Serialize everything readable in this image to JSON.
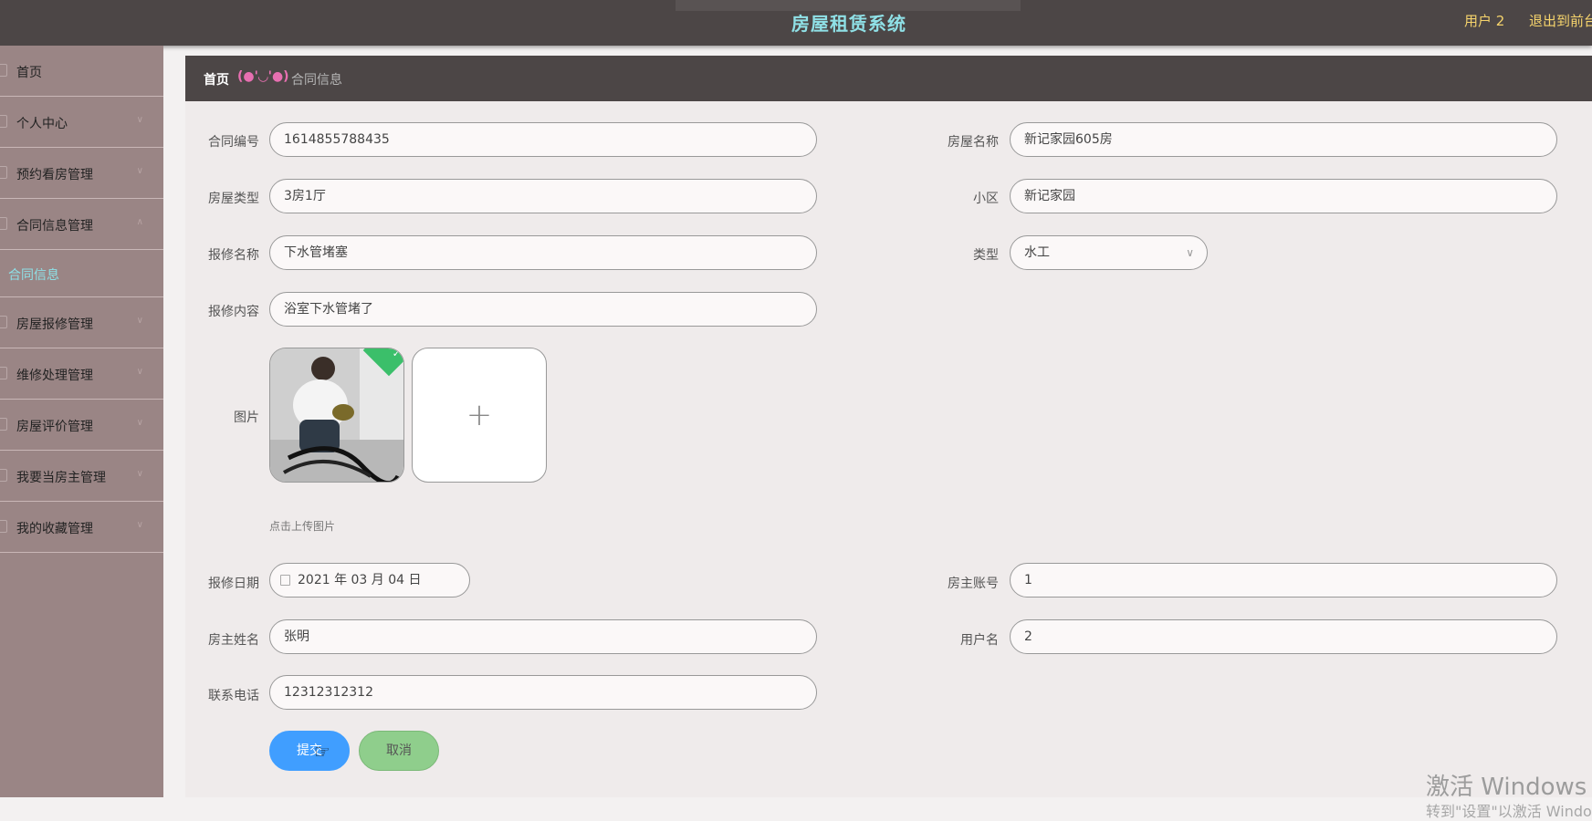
{
  "header": {
    "title": "房屋租赁系统",
    "user": "用户 2",
    "logout": "退出到前台"
  },
  "sidebar": {
    "items": [
      {
        "label": "首页"
      },
      {
        "label": "个人中心"
      },
      {
        "label": "预约看房管理"
      },
      {
        "label": "合同信息管理"
      },
      {
        "label": "合同信息",
        "active": true
      },
      {
        "label": "房屋报修管理"
      },
      {
        "label": "维修处理管理"
      },
      {
        "label": "房屋评价管理"
      },
      {
        "label": "我要当房主管理"
      },
      {
        "label": "我的收藏管理"
      }
    ]
  },
  "breadcrumb": {
    "home": "首页",
    "face": "(●'◡'●)",
    "current": "合同信息"
  },
  "form": {
    "contract_no": {
      "label": "合同编号",
      "value": "1614855788435"
    },
    "house_name": {
      "label": "房屋名称",
      "value": "新记家园605房"
    },
    "house_type": {
      "label": "房屋类型",
      "value": "3房1厅"
    },
    "community": {
      "label": "小区",
      "value": "新记家园"
    },
    "repair_name": {
      "label": "报修名称",
      "value": "下水管堵塞"
    },
    "type": {
      "label": "类型",
      "value": "水工"
    },
    "repair_content": {
      "label": "报修内容",
      "value": "浴室下水管堵了"
    },
    "image": {
      "label": "图片",
      "hint": "点击上传图片"
    },
    "repair_date": {
      "label": "报修日期",
      "value": "2021 年 03 月 04 日"
    },
    "owner_account": {
      "label": "房主账号",
      "value": "1"
    },
    "owner_name": {
      "label": "房主姓名",
      "value": "张明"
    },
    "username": {
      "label": "用户名",
      "value": "2"
    },
    "phone": {
      "label": "联系电话",
      "value": "12312312312"
    }
  },
  "buttons": {
    "submit": "提交",
    "cancel": "取消"
  },
  "watermark": {
    "line1": "激活 Windows",
    "line2": "转到\"设置\"以激活 Windows。"
  },
  "colors": {
    "header_bg": "#4c4646",
    "title": "#8fe0e6",
    "sidebar_bg": "#9a8585",
    "submit": "#409eff",
    "cancel": "#8fce8c"
  }
}
